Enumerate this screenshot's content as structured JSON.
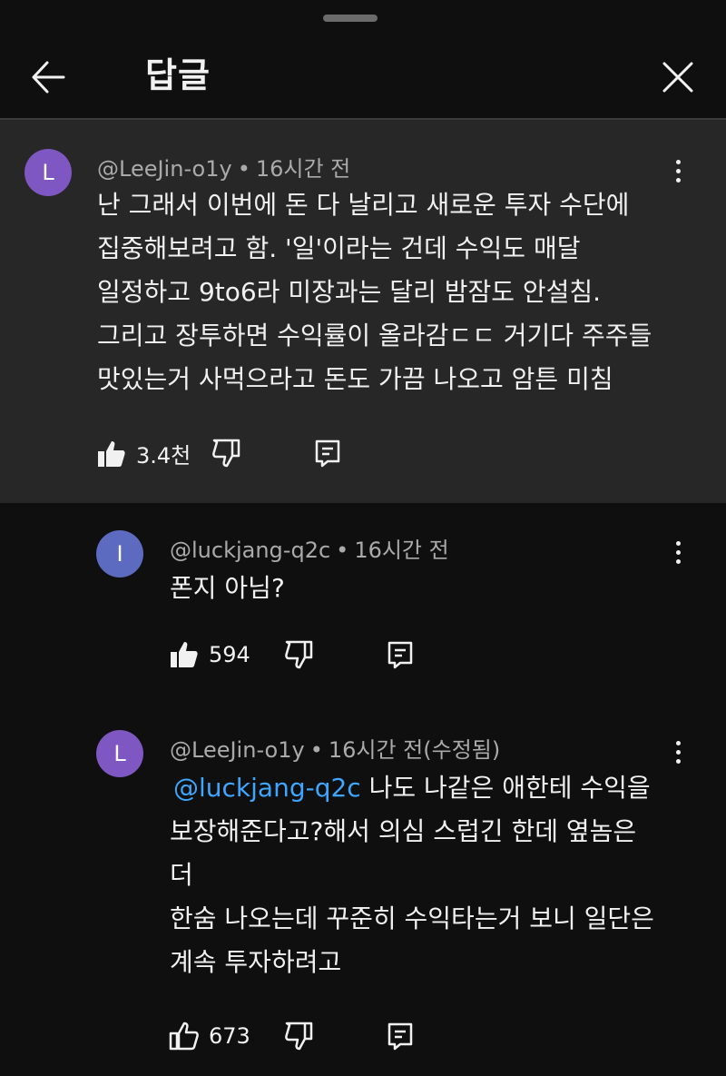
{
  "header": {
    "title": "답글"
  },
  "comments": [
    {
      "avatar_letter": "L",
      "avatar_color": "#7e57c2",
      "handle": "@LeeJin-o1y",
      "time": "16시간 전",
      "lines": [
        "난 그래서 이번에 돈 다 날리고 새로운 투자 수단에",
        "집중해보려고 함.  '일'이라는 건데 수익도 매달",
        "일정하고 9to6라 미장과는 달리 밤잠도 안설침.",
        "그리고 장투하면 수익률이 올라감ㄷㄷ 거기다 주주들",
        "맛있는거 사먹으라고 돈도 가끔 나오고 암튼 미침"
      ],
      "likes": "3.4천"
    },
    {
      "avatar_letter": "I",
      "avatar_color": "#5c6bc0",
      "handle": "@luckjang-q2c",
      "time": "16시간 전",
      "lines": [
        "폰지 아님?"
      ],
      "likes": "594"
    },
    {
      "avatar_letter": "L",
      "avatar_color": "#7e57c2",
      "handle": "@LeeJin-o1y",
      "time": "16시간 전(수정됨)",
      "mention": "@luckjang-q2c",
      "first_line_rest": " 나도 나같은 애한테 수익을",
      "lines": [
        "보장해준다고?해서 의심 스럽긴 한데 옆놈은",
        "더",
        "한숨 나오는데 꾸준히 수익타는거 보니 일단은",
        "계속 투자하려고"
      ],
      "likes": "673"
    }
  ],
  "icons": {
    "back": "arrow-left-icon",
    "close": "close-icon",
    "more": "more-vert-icon",
    "like": "thumbs-up-icon",
    "dislike": "thumbs-down-icon",
    "reply": "reply-icon"
  }
}
